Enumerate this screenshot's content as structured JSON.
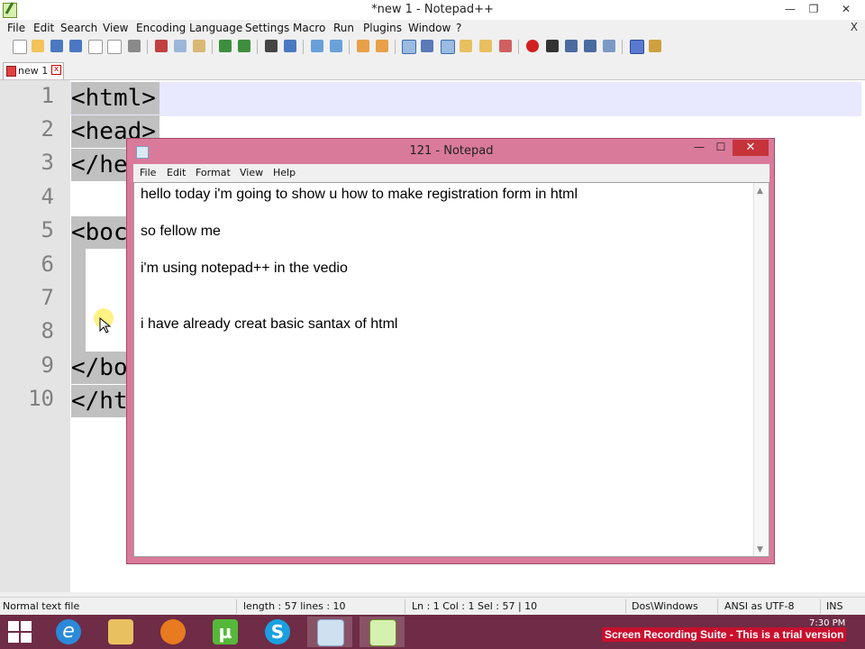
{
  "npp": {
    "title": "*new  1 - Notepad++",
    "menu": [
      "File",
      "Edit",
      "Search",
      "View",
      "Encoding",
      "Language",
      "Settings",
      "Macro",
      "Run",
      "Plugins",
      "Window",
      "?"
    ],
    "close_doc": "X",
    "tab_label": "new  1",
    "line_numbers": [
      "1",
      "2",
      "3",
      "4",
      "5",
      "6",
      "7",
      "8",
      "9",
      "10"
    ],
    "code_lines": [
      "<html>",
      "<head>",
      "</he",
      "",
      "<boc",
      "",
      "",
      "",
      "</bo",
      "</ht"
    ],
    "status": {
      "file_type": "Normal text file",
      "length": "length : 57    lines : 10",
      "position": "Ln : 1    Col : 1    Sel : 57 | 10",
      "eol": "Dos\\Windows",
      "encoding": "ANSI as UTF-8",
      "mode": "INS"
    }
  },
  "notepad": {
    "title": "121 - Notepad",
    "menu": [
      "File",
      "Edit",
      "Format",
      "View",
      "Help"
    ],
    "lines": [
      "hello today i'm going to show u how to make registration form in html",
      "so fellow me",
      "i'm using notepad++ in the vedio",
      "i have already creat basic santax of html"
    ]
  },
  "taskbar": {
    "apps": [
      "internet-explorer",
      "file-explorer",
      "firefox",
      "utorrent",
      "skype",
      "notepad",
      "notepad-plus-plus"
    ],
    "recording_notice": "Screen Recording Suite - This is a trial version",
    "clock": "7:30 PM"
  },
  "colors": {
    "notepad_frame": "#d97a9a",
    "taskbar": "#6e2c46",
    "selection": "#c0c0c0",
    "current_line": "#e8e8ff"
  }
}
